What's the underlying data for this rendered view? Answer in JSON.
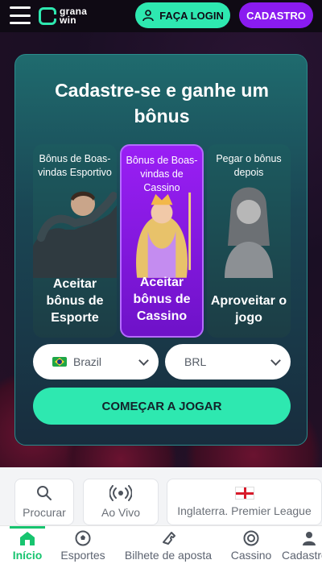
{
  "header": {
    "logo_line1": "grana",
    "logo_line2": "win",
    "login_label": "FAÇA LOGIN",
    "signup_label": "CADASTRO"
  },
  "modal": {
    "title": "Cadastre-se e ganhe um bônus",
    "cards": [
      {
        "top": "Bônus de Boas-vindas Esportivo",
        "bottom": "Aceitar bônus de Esporte"
      },
      {
        "top": "Bônus de Boas-vindas de Cassino",
        "bottom": "Aceitar bônus de Cassino"
      },
      {
        "top": "Pegar o bônus depois",
        "bottom": "Aproveitar o jogo"
      }
    ],
    "country_value": "Brazil",
    "currency_value": "BRL",
    "start_label": "COMEÇAR A JOGAR"
  },
  "quick_nav": {
    "search_label": "Procurar",
    "live_label": "Ao Vivo",
    "league_label": "Inglaterra. Premier League"
  },
  "bottom_nav": {
    "items": [
      {
        "label": "Início"
      },
      {
        "label": "Esportes"
      },
      {
        "label": "Bilhete de aposta"
      },
      {
        "label": "Cassino"
      },
      {
        "label": "Cadastro"
      }
    ]
  },
  "colors": {
    "accent_green": "#2ee8b0",
    "accent_purple": "#8a1bf0",
    "active_nav": "#17c46f"
  }
}
